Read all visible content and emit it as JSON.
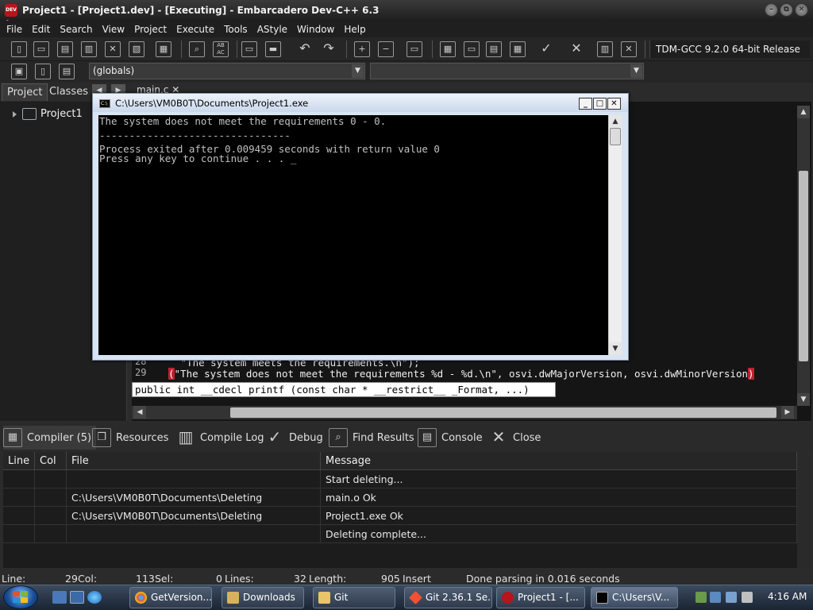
{
  "window": {
    "title": "Project1 - [Project1.dev] - [Executing] - Embarcadero Dev-C++ 6.3",
    "app_icon_text": "DEV C++"
  },
  "menu": [
    "File",
    "Edit",
    "Search",
    "View",
    "Project",
    "Execute",
    "Tools",
    "AStyle",
    "Window",
    "Help"
  ],
  "toolbar": {
    "compiler": "TDM-GCC 9.2.0 64-bit Release",
    "scope": "(globals)"
  },
  "left_panel": {
    "tabs": [
      "Project",
      "Classes"
    ],
    "tree_root": "Project1"
  },
  "editor": {
    "tab_label": "main.c",
    "lines": [
      {
        "number": "28",
        "text": " \"The system meets the requirements.\\n\");"
      },
      {
        "number": "29",
        "text": "\"The system does not meet the requirements %d - %d.\\n\", osvi.dwMajorVersion, osvi.dwMinorVersion"
      }
    ],
    "tooltip": "public int __cdecl printf (const char * __restrict__ _Format, ...)"
  },
  "console": {
    "title": "C:\\Users\\VM0B0T\\Documents\\Project1.exe",
    "icon_text": "C:\\",
    "lines": [
      "The system does not meet the requirements 0 - 0.",
      "",
      "--------------------------------",
      "Process exited after 0.009459 seconds with return value 0",
      "Press any key to continue . . . _"
    ]
  },
  "bottom_tabs": [
    "Compiler (5)",
    "Resources",
    "Compile Log",
    "Debug",
    "Find Results",
    "Console",
    "Close"
  ],
  "messages": {
    "columns": [
      "Line",
      "Col",
      "File",
      "Message"
    ],
    "rows": [
      {
        "line": "",
        "col": "",
        "file": "",
        "message": "Start deleting..."
      },
      {
        "line": "",
        "col": "",
        "file": "C:\\Users\\VM0B0T\\Documents\\Deleting",
        "message": "main.o Ok"
      },
      {
        "line": "",
        "col": "",
        "file": "C:\\Users\\VM0B0T\\Documents\\Deleting",
        "message": "Project1.exe Ok"
      },
      {
        "line": "",
        "col": "",
        "file": "",
        "message": "Deleting complete..."
      }
    ]
  },
  "status": {
    "line_label": "Line:",
    "line": "29",
    "col_label": "Col:",
    "col": "113",
    "sel_label": "Sel:",
    "sel": "0",
    "lines_label": "Lines:",
    "lines": "32",
    "length_label": "Length:",
    "length": "905",
    "mode": "Insert",
    "message": "Done parsing in 0.016 seconds"
  },
  "taskbar": {
    "tasks": [
      "GetVersion...",
      "Downloads",
      "Git",
      "Git 2.36.1 Se...",
      "Project1 - [...",
      "C:\\Users\\V..."
    ],
    "clock": "4:16 AM"
  }
}
